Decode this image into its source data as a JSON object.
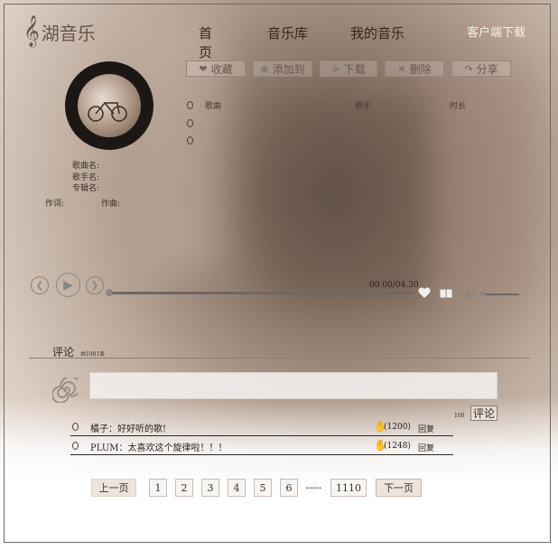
{
  "app": {
    "name": "湖音乐",
    "clef_icon": "treble-clef-icon"
  },
  "nav": {
    "home": "首页",
    "library": "音乐库",
    "my_music": "我的音乐",
    "client_download": "客户端下载"
  },
  "toolbar": {
    "favorite": "收藏",
    "add_to": "添加到",
    "download": "下载",
    "delete": "删除",
    "share": "分享"
  },
  "song_info": {
    "song_label": "歌曲名:",
    "artist_label": "歌手名:",
    "album_label": "专辑名:",
    "lyricist_label": "作词:",
    "composer_label": "作曲:"
  },
  "list_header": {
    "song": "歌曲",
    "artist": "歌手",
    "duration": "时长"
  },
  "player": {
    "time": "00.00/04.30",
    "progress": 0.0
  },
  "comments": {
    "title": "评论",
    "count": "共1001条",
    "char_limit": "100",
    "submit_label": "评论",
    "items": [
      {
        "text": "橘子：好好听的歌!",
        "likes": "(1200)",
        "reply": "回复"
      },
      {
        "text": "PLUM：太喜欢这个旋律啦！！！",
        "likes": "(1248)",
        "reply": "回复"
      }
    ]
  },
  "pagination": {
    "prev": "上一页",
    "pages": [
      "1",
      "2",
      "3",
      "4",
      "5",
      "6"
    ],
    "ellipsis": "·······",
    "last": "1110",
    "next": "下一页"
  },
  "colors": {
    "accent_text": "#6b5447",
    "nav_text": "#3a2418",
    "border": "#9b8576"
  }
}
